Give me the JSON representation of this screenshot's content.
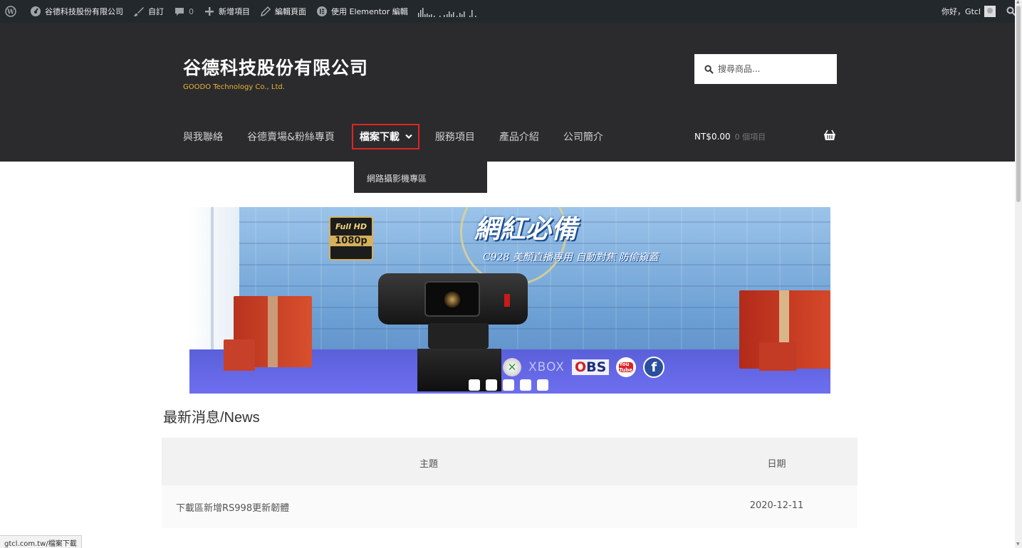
{
  "admin_bar": {
    "site_name": "谷德科技股份有限公司",
    "customize": "自訂",
    "comments_count": "0",
    "new_item": "新增項目",
    "edit_page": "編輯頁面",
    "elementor": "使用 Elementor 編輯",
    "greeting": "你好，Gtcl"
  },
  "header": {
    "site_title": "谷德科技股份有限公司",
    "site_description": "GOODO Technology Co., Ltd.",
    "search_placeholder": "搜尋商品...",
    "nav": [
      "與我聯絡",
      "谷德賣場&粉絲專頁",
      "檔案下載",
      "服務項目",
      "產品介紹",
      "公司簡介"
    ],
    "active_nav": "檔案下載",
    "cart_amount": "NT$0.00",
    "cart_count": "0 個項目"
  },
  "dropdown": {
    "items": [
      "網路攝影機專區"
    ]
  },
  "banner": {
    "fullhd_line1": "Full HD",
    "fullhd_line2": "1080p",
    "slogan": "網紅必備",
    "subslogan": "C928 美顏直播專用 自動對焦 防偷窺蓋",
    "xbox": "XBOX",
    "obs": "OBS",
    "youtube": "You Tube",
    "facebook": "f",
    "slide_count": 5
  },
  "news": {
    "heading": "最新消息/News",
    "columns": [
      "主題",
      "日期"
    ],
    "rows": [
      {
        "topic": "下載區新增RS998更新韌體",
        "date": "2020-12-11"
      }
    ]
  },
  "status_bar": {
    "url": "gtcl.com.tw/檔案下載"
  },
  "colors": {
    "admin_bar": "#23282d",
    "header_bg": "#2b2b2d",
    "tagline": "#e8b33a",
    "active_border": "#e02424"
  }
}
